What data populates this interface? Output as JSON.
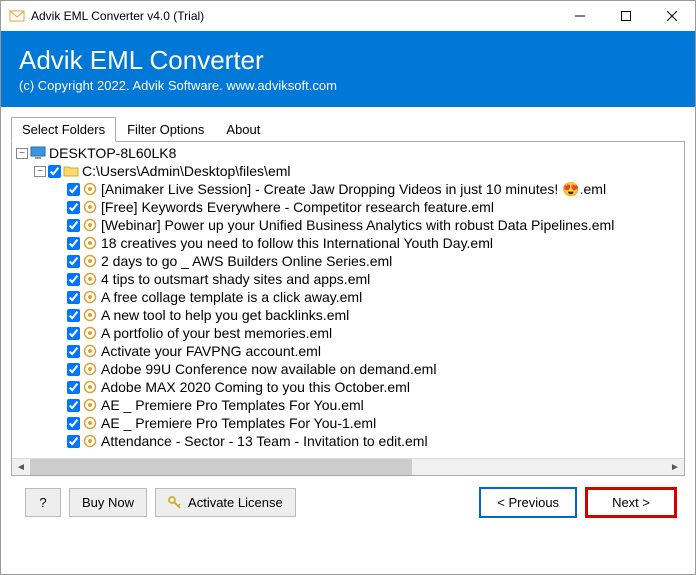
{
  "window": {
    "title": "Advik EML Converter v4.0 (Trial)"
  },
  "banner": {
    "title": "Advik EML Converter",
    "subtitle": "(c) Copyright 2022. Advik Software. www.adviksoft.com"
  },
  "tabs": [
    {
      "label": "Select Folders",
      "active": true
    },
    {
      "label": "Filter Options",
      "active": false
    },
    {
      "label": "About",
      "active": false
    }
  ],
  "tree": {
    "root": {
      "label": "DESKTOP-8L60LK8",
      "expanded": true,
      "folder": {
        "label": "C:\\Users\\Admin\\Desktop\\files\\eml",
        "expanded": true,
        "checked": true,
        "files": [
          "[Animaker Live Session] - Create Jaw Dropping Videos in just 10 minutes! 😍.eml",
          "[Free] Keywords Everywhere - Competitor research feature.eml",
          "[Webinar] Power up your Unified Business Analytics with robust Data Pipelines.eml",
          "18 creatives you need to follow this International Youth Day.eml",
          "2 days to go _ AWS Builders Online Series.eml",
          "4 tips to outsmart shady sites and apps.eml",
          "A free collage template is a click away.eml",
          "A new tool to help you get backlinks.eml",
          "A portfolio of your best memories.eml",
          "Activate your FAVPNG account.eml",
          "Adobe 99U Conference now available on demand.eml",
          "Adobe MAX 2020 Coming to you this October.eml",
          "AE _ Premiere Pro Templates For You.eml",
          "AE _ Premiere Pro Templates For You-1.eml",
          "Attendance - Sector - 13 Team - Invitation to edit.eml"
        ]
      }
    }
  },
  "footer": {
    "help": "?",
    "buy": "Buy Now",
    "activate": "Activate License",
    "prev": "<  Previous",
    "next": "Next >"
  }
}
